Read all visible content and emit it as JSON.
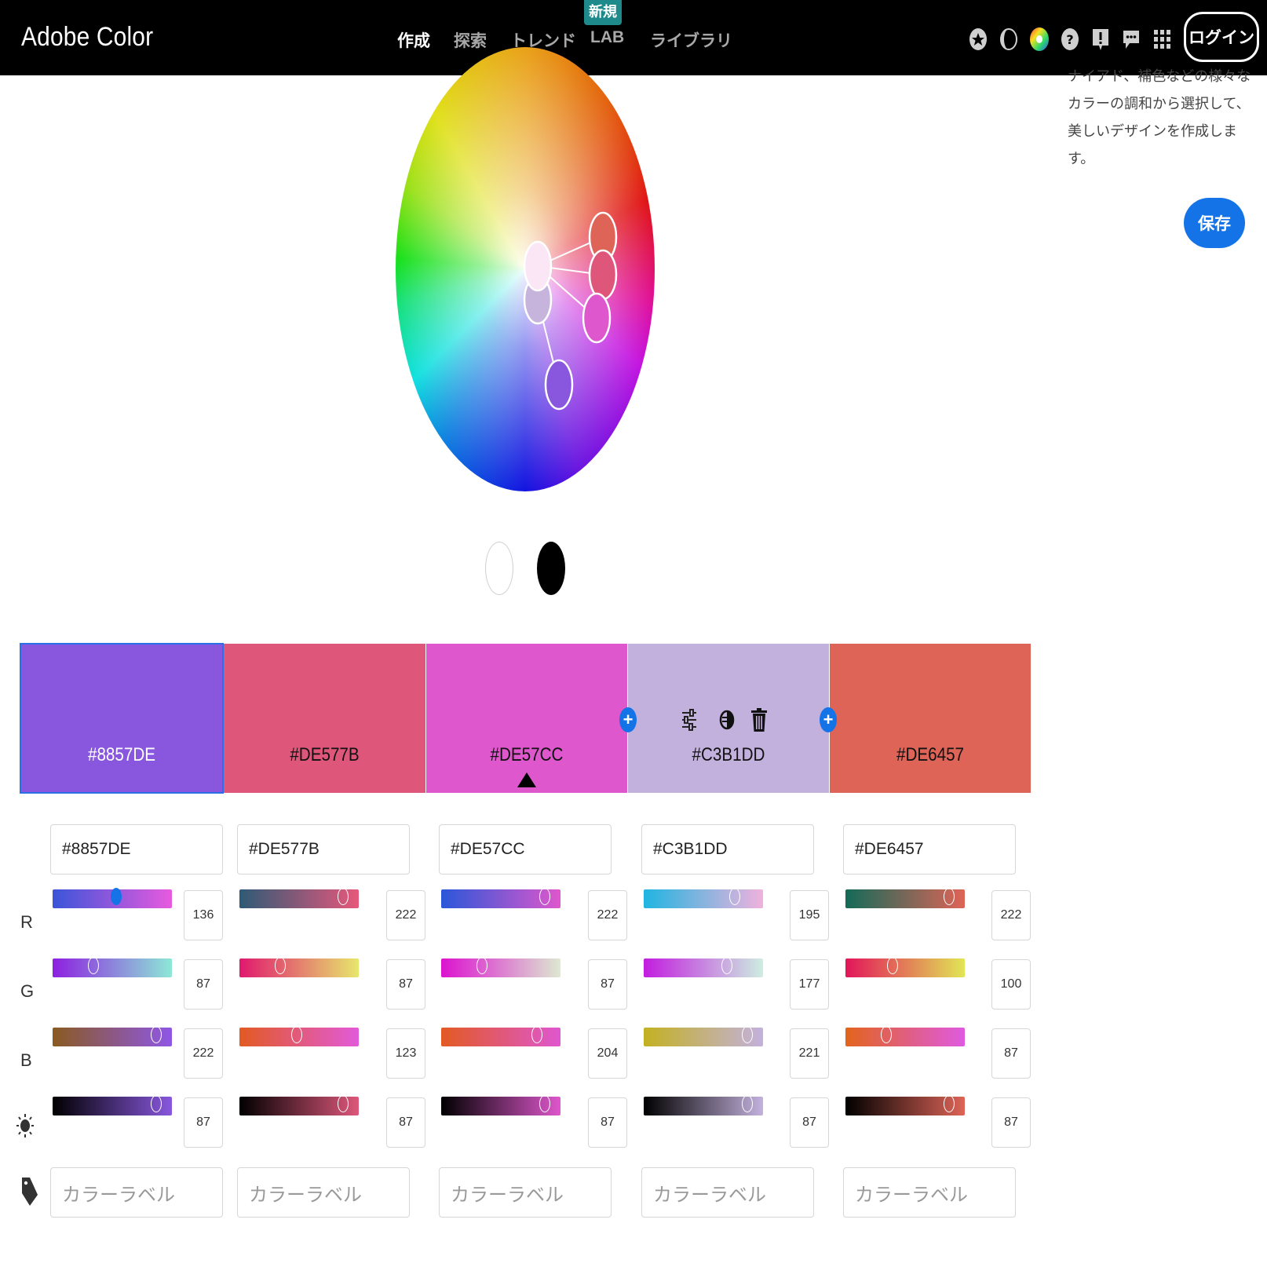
{
  "header": {
    "logo": "Adobe Color",
    "nav": [
      {
        "label": "作成",
        "active": true
      },
      {
        "label": "探索",
        "active": false
      },
      {
        "label": "トレンド",
        "active": false
      },
      {
        "label": "LAB",
        "active": false
      },
      {
        "label": "ライブラリ",
        "active": false
      }
    ],
    "new_badge": "新規",
    "icons": [
      "star-badge-icon",
      "contrast-moon-icon",
      "color-wheel-icon",
      "help-icon",
      "alert-icon",
      "feedback-icon",
      "apps-grid-icon"
    ],
    "login_label": "ログイン"
  },
  "side_panel": {
    "description": "ナイアド、補色などの様々なカラーの調和から選択して、美しいデザインを作成します。",
    "save_label": "保存"
  },
  "swatches": [
    {
      "hex": "#8857DE",
      "color": "#8857DE",
      "selected": true
    },
    {
      "hex": "#DE577B",
      "color": "#DE577B",
      "selected": false
    },
    {
      "hex": "#DE57CC",
      "color": "#DE57CC",
      "selected": false,
      "base": true
    },
    {
      "hex": "#C3B1DD",
      "color": "#C3B1DD",
      "selected": false
    },
    {
      "hex": "#DE6457",
      "color": "#DE6457",
      "selected": false
    }
  ],
  "swatch_tools": [
    "adjust-sliders-icon",
    "contrast-icon",
    "trash-icon"
  ],
  "row_labels": {
    "r": "R",
    "g": "G",
    "b": "B"
  },
  "controls": [
    {
      "hex": "#8857DE",
      "r": 136,
      "g": 87,
      "b": 222,
      "brightness": 87,
      "label_placeholder": "カラーラベル"
    },
    {
      "hex": "#DE577B",
      "r": 222,
      "g": 87,
      "b": 123,
      "brightness": 87,
      "label_placeholder": "カラーラベル"
    },
    {
      "hex": "#DE57CC",
      "r": 222,
      "g": 87,
      "b": 204,
      "brightness": 87,
      "label_placeholder": "カラーラベル"
    },
    {
      "hex": "#C3B1DD",
      "r": 195,
      "g": 177,
      "b": 221,
      "brightness": 87,
      "label_placeholder": "カラーラベル"
    },
    {
      "hex": "#DE6457",
      "r": 222,
      "g": 100,
      "b": 87,
      "brightness": 87,
      "label_placeholder": "カラーラベル"
    }
  ]
}
